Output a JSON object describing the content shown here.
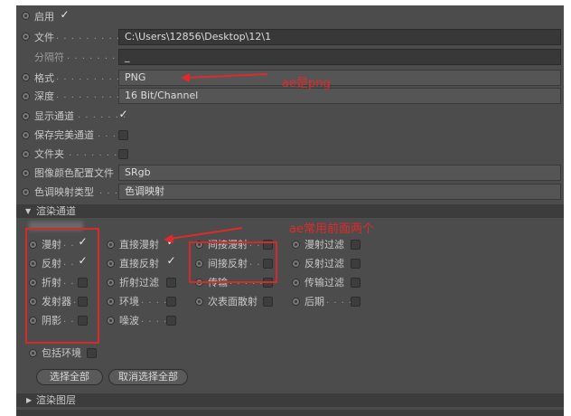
{
  "rows": {
    "enable": {
      "label": "启用",
      "checked": true
    },
    "file": {
      "label": "文件",
      "dots": ". . . . . . . . . . .",
      "value": "C:\\Users\\12856\\Desktop\\12\\1"
    },
    "separator": {
      "label": "分隔符",
      "dots": ". . . . . . . . .",
      "value": "_"
    },
    "format": {
      "label": "格式",
      "dots": ". . . . . . . . . . .",
      "value": "PNG"
    },
    "depth": {
      "label": "深度",
      "dots": ". . . . . . . . . . .",
      "value": "16 Bit/Channel"
    },
    "show_channel": {
      "label": "显示通道",
      "dots": ". . . . . . .",
      "checked": true
    },
    "save_perfect": {
      "label": "保存完美通道",
      "dots": ". . . .",
      "checked": false
    },
    "folder": {
      "label": "文件夹",
      "dots": ". . . . . . . .",
      "checked": false
    },
    "color_profile": {
      "label": "图像颜色配置文件",
      "value": "SRgb"
    },
    "tone_mapping": {
      "label": "色调映射类型",
      "dots": ". . .",
      "value": "色调映射"
    }
  },
  "render_channels": {
    "header": "渲染通道",
    "columns": [
      [
        {
          "label": "漫射",
          "dots": ". .",
          "checked": true
        },
        {
          "label": "反射",
          "dots": ". .",
          "checked": true
        },
        {
          "label": "折射",
          "dots": ". .",
          "checked": false
        },
        {
          "label": "发射器",
          "dots": ". .",
          "checked": false
        },
        {
          "label": "阴影",
          "dots": ". .",
          "checked": false
        }
      ],
      [
        {
          "label": "直接漫射",
          "dots": "",
          "checked": true
        },
        {
          "label": "直接反射",
          "dots": "",
          "checked": true
        },
        {
          "label": "折射过滤",
          "dots": "",
          "checked": false
        },
        {
          "label": "环境",
          "dots": ". . . . .",
          "checked": false
        },
        {
          "label": "噪波",
          "dots": ". . . . .",
          "checked": false
        }
      ],
      [
        {
          "label": "间接漫射",
          "dots": ". .",
          "checked": false
        },
        {
          "label": "间接反射",
          "dots": ". .",
          "checked": false
        },
        {
          "label": "传输",
          "dots": ". . . . . .",
          "checked": false
        },
        {
          "label": "次表面散射",
          "dots": "",
          "checked": false
        }
      ],
      [
        {
          "label": "漫射过滤",
          "dots": "",
          "checked": false
        },
        {
          "label": "反射过滤",
          "dots": "",
          "checked": false
        },
        {
          "label": "传输过滤",
          "dots": "",
          "checked": false
        },
        {
          "label": "后期",
          "dots": ". . . . .",
          "checked": false
        }
      ]
    ],
    "include_env": {
      "label": "包括环境",
      "checked": false
    },
    "select_all": "选择全部",
    "deselect_all": "取消选择全部"
  },
  "render_layers": {
    "header": "渲染图层"
  },
  "annotations": {
    "format_note": "ae是png",
    "channels_note": "ae常用前面两个"
  },
  "colors": {
    "annotation": "#e02a2a",
    "panel": "#4c4c4c",
    "field": "#383838"
  }
}
